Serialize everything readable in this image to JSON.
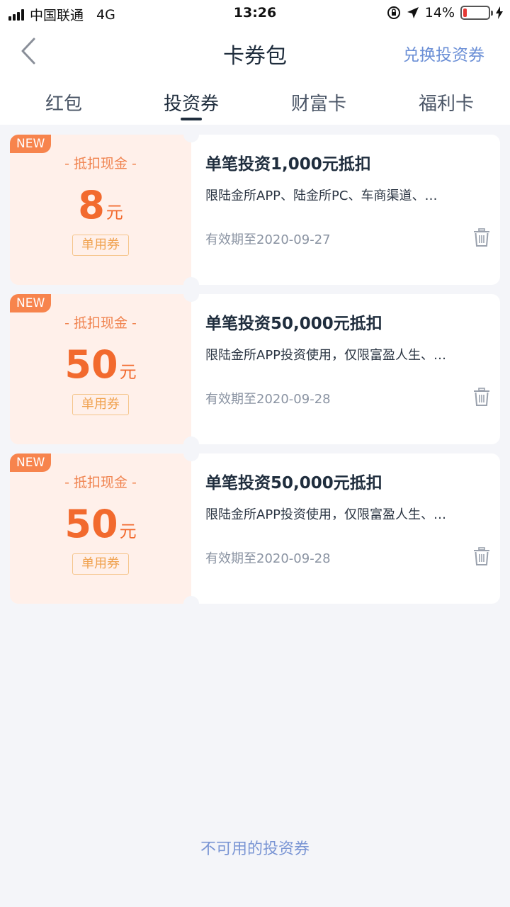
{
  "status_bar": {
    "carrier": "中国联通",
    "network": "4G",
    "time": "13:26",
    "battery": "14%",
    "battery_level": 0.14
  },
  "header": {
    "title": "卡券包",
    "action_label": "兑换投资券"
  },
  "tabs": [
    {
      "label": "红包"
    },
    {
      "label": "投资券"
    },
    {
      "label": "财富卡"
    },
    {
      "label": "福利卡"
    }
  ],
  "coupons": [
    {
      "badge": "NEW",
      "type": "- 抵扣现金 -",
      "amount": "8",
      "unit": "元",
      "tag": "单用券",
      "title": "单笔投资1,000元抵扣",
      "description": "限陆金所APP、陆金所PC、车商渠道、…",
      "expiry": "有效期至2020-09-27"
    },
    {
      "badge": "NEW",
      "type": "- 抵扣现金 -",
      "amount": "50",
      "unit": "元",
      "tag": "单用券",
      "title": "单笔投资50,000元抵扣",
      "description": "限陆金所APP投资使用，仅限富盈人生、…",
      "expiry": "有效期至2020-09-28"
    },
    {
      "badge": "NEW",
      "type": "- 抵扣现金 -",
      "amount": "50",
      "unit": "元",
      "tag": "单用券",
      "title": "单笔投资50,000元抵扣",
      "description": "限陆金所APP投资使用，仅限富盈人生、…",
      "expiry": "有效期至2020-09-28"
    }
  ],
  "footer_link": "不可用的投资券",
  "colors": {
    "accent": "#f26a2e",
    "link": "#6b8fd6",
    "coupon_bg": "#fff0ea"
  }
}
